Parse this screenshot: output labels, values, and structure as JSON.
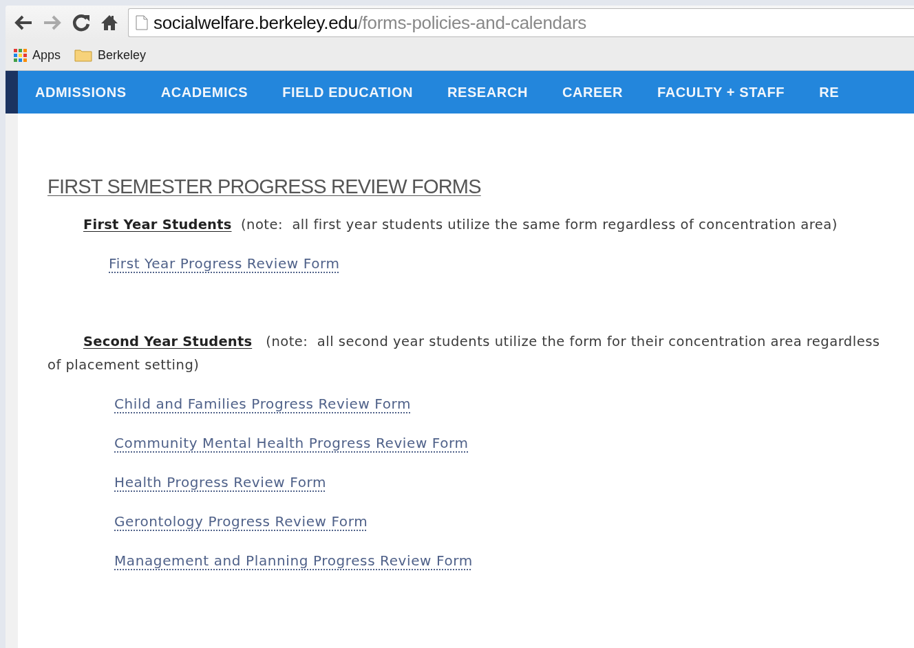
{
  "browser": {
    "url": {
      "host": "socialwelfare.berkeley.edu",
      "path": "/forms-policies-and-calendars"
    },
    "bookmarks": [
      {
        "label": "Apps",
        "kind": "apps"
      },
      {
        "label": "Berkeley",
        "kind": "folder"
      }
    ]
  },
  "nav_menu": [
    "ADMISSIONS",
    "ACADEMICS",
    "FIELD EDUCATION",
    "RESEARCH",
    "CAREER",
    "FACULTY + STAFF",
    "RE"
  ],
  "content": {
    "heading": "FIRST SEMESTER PROGRESS REVIEW FORMS",
    "sections": [
      {
        "text": "**First Year Students**  (note:  all first year students utilize the same form regardless of concentration area)",
        "links": [
          "First Year Progress Review Form"
        ]
      },
      {
        "text": "**Second Year Students**   (note:  all second year students utilize the form for their concentration area regardless of placement setting)",
        "links": [
          "Child and Families Progress Review Form",
          "Community Mental Health Progress Review Form",
          "Health Progress Review Form",
          "Gerontology Progress Review Form",
          "Management and Planning Progress Review Form"
        ]
      }
    ]
  }
}
